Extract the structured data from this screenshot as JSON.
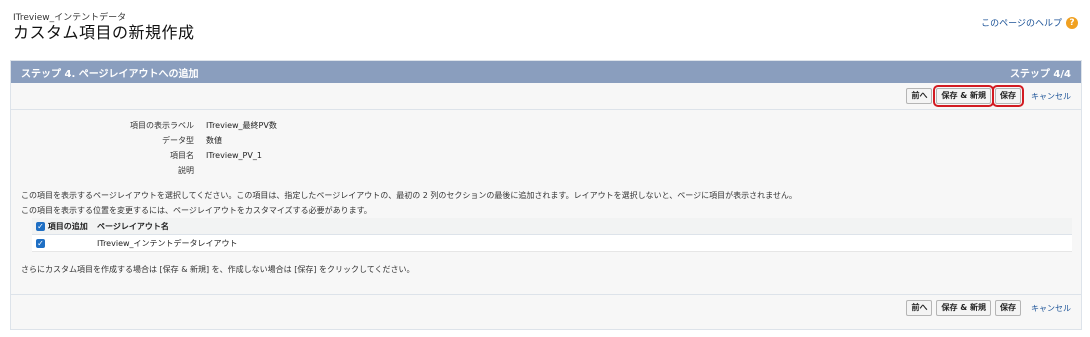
{
  "header": {
    "breadcrumb": "ITreview_インテントデータ",
    "title": "カスタム項目の新規作成",
    "help_link": "このページのヘルプ",
    "help_icon": "?"
  },
  "step": {
    "title": "ステップ 4. ページレイアウトへの追加",
    "counter": "ステップ 4/4"
  },
  "buttons": {
    "prev": "前へ",
    "save_new": "保存 & 新規",
    "save": "保存",
    "cancel": "キャンセル"
  },
  "fields": [
    {
      "label": "項目の表示ラベル",
      "value": "ITreview_最終PV数"
    },
    {
      "label": "データ型",
      "value": "数値"
    },
    {
      "label": "項目名",
      "value": "ITreview_PV_1"
    },
    {
      "label": "説明",
      "value": ""
    }
  ],
  "info": {
    "line1": "この項目を表示するページレイアウトを選択してください。この項目は、指定したページレイアウトの、最初の 2 列のセクションの最後に追加されます。レイアウトを選択しないと、ページに項目が表示されません。",
    "line2": "この項目を表示する位置を変更するには、ページレイアウトをカスタマイズする必要があります。",
    "footer": "さらにカスタム項目を作成する場合は [保存 & 新規] を、作成しない場合は [保存] をクリックしてください。"
  },
  "table": {
    "headers": [
      "項目の追加",
      "ページレイアウト名"
    ],
    "rows": [
      {
        "layout": "ITreview_インテントデータレイアウト"
      }
    ],
    "check_glyph": "✓"
  }
}
